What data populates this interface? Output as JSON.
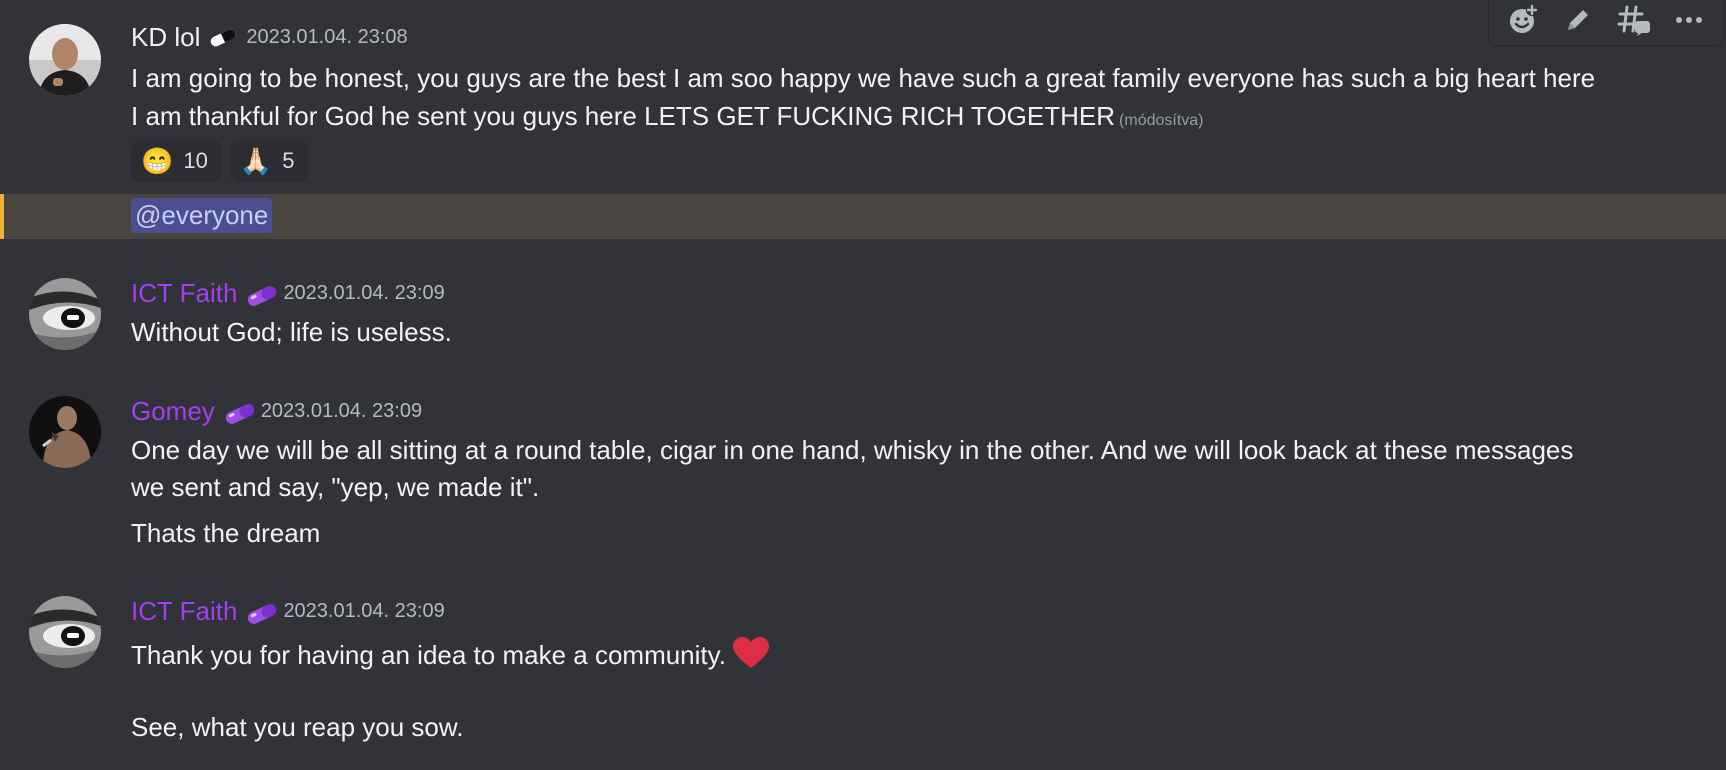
{
  "colors": {
    "background": "#313338",
    "mention_highlight": "#4a4540",
    "mention_bar": "#f0b232",
    "purple_name": "#a23ff0",
    "default_name": "#f2f3f5"
  },
  "toolbar": {
    "icons": [
      "add-reaction-icon",
      "edit-icon",
      "create-thread-icon",
      "more-icon"
    ]
  },
  "messages": [
    {
      "username": "KD lol",
      "name_color": "#f2f3f5",
      "badge": "pill-badge-white",
      "timestamp": "2023.01.04. 23:08",
      "lines": [
        "I am going to be honest, you guys are the best I am soo happy we have such a great family everyone has such a big heart here",
        "I am thankful for God he sent you guys here LETS GET FUCKING RICH TOGETHER"
      ],
      "edited": "(módosítva)",
      "reactions": [
        {
          "emoji": "😁",
          "count": "10"
        },
        {
          "emoji": "🙏🏻",
          "count": "5"
        }
      ],
      "mention": "@everyone"
    },
    {
      "username": "ICT Faith",
      "name_color": "#a23ff0",
      "badge": "pill-badge-purple",
      "timestamp": "2023.01.04. 23:09",
      "lines": [
        "Without God; life is useless."
      ]
    },
    {
      "username": "Gomey",
      "name_color": "#a23ff0",
      "badge": "pill-badge-purple",
      "timestamp": "2023.01.04. 23:09",
      "lines": [
        "One day we will be all sitting at a round table, cigar in one hand, whisky in the other. And we will look back at these messages",
        "we sent and say, \"yep, we made it\".",
        "Thats the dream"
      ]
    },
    {
      "username": "ICT Faith",
      "name_color": "#a23ff0",
      "badge": "pill-badge-purple",
      "timestamp": "2023.01.04. 23:09",
      "lines": [
        "Thank you for having an idea to make a community.",
        "See, what you reap you sow."
      ],
      "emoji": "heart-emoji"
    }
  ]
}
